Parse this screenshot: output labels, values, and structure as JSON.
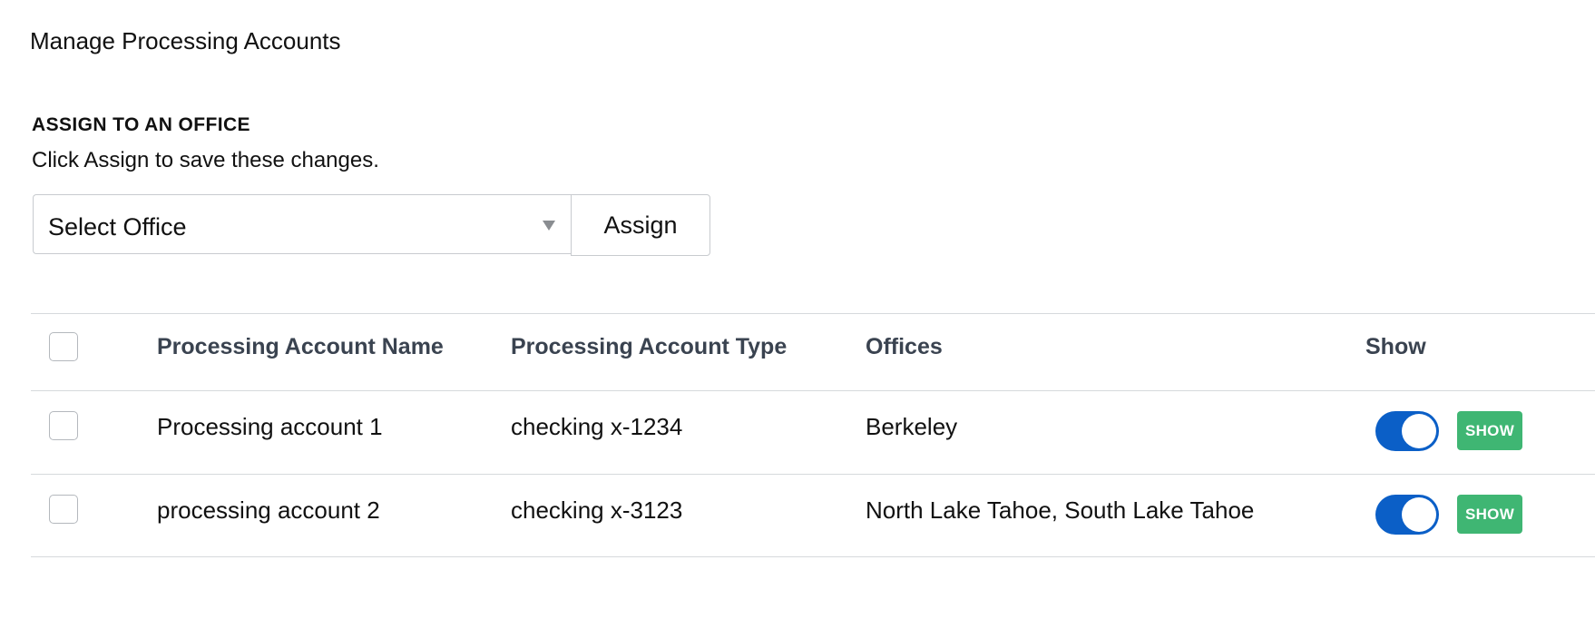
{
  "page": {
    "title": "Manage Processing Accounts"
  },
  "assign": {
    "heading": "ASSIGN TO AN OFFICE",
    "hint": "Click Assign to save these changes.",
    "select_value": "Select Office",
    "button_label": "Assign"
  },
  "table": {
    "headers": {
      "name": "Processing Account Name",
      "type": "Processing Account Type",
      "offices": "Offices",
      "show": "Show"
    },
    "rows": [
      {
        "name": "Processing account 1",
        "type": "checking x-1234",
        "offices": "Berkeley",
        "checked": false,
        "show_enabled": true,
        "badge": "SHOW"
      },
      {
        "name": "processing account 2",
        "type": "checking x-3123",
        "offices": "North Lake Tahoe, South Lake Tahoe",
        "checked": false,
        "show_enabled": true,
        "badge": "SHOW"
      }
    ]
  },
  "colors": {
    "toggle_on": "#0b5fc7",
    "badge_green": "#3fb673",
    "header_text": "#3a4350"
  }
}
